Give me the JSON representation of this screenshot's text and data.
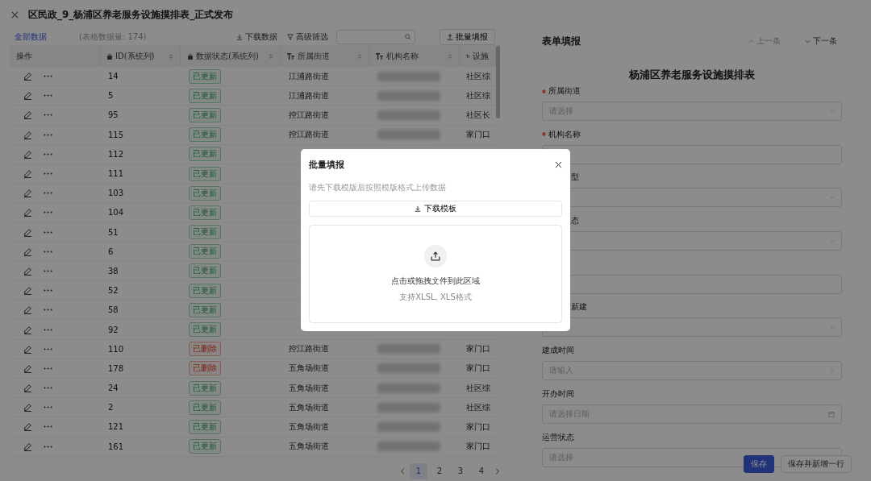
{
  "window": {
    "title": "区民政_9_杨浦区养老服务设施摸排表_正式发布"
  },
  "toolbar": {
    "view_tab": {
      "label": "全部数据",
      "selected": true
    },
    "count": "(表格数据量: 174)",
    "download": "下载数据",
    "filter": "高级筛选",
    "batch": "批量填报"
  },
  "table": {
    "columns": [
      {
        "label": "操作",
        "kind": "plain"
      },
      {
        "label": "ID(系统列)",
        "kind": "locked"
      },
      {
        "label": "数据状态(系统列)",
        "kind": "locked"
      },
      {
        "label": "所属街道",
        "kind": "text"
      },
      {
        "label": "机构名称",
        "kind": "text"
      },
      {
        "label": "设施",
        "kind": "text"
      }
    ],
    "rows": [
      {
        "id": "14",
        "status": "已更新",
        "kind": "updated",
        "street": "江浦路街道",
        "facility": "社区综"
      },
      {
        "id": "5",
        "status": "已更新",
        "kind": "updated",
        "street": "江浦路街道",
        "facility": "社区综"
      },
      {
        "id": "95",
        "status": "已更新",
        "kind": "updated",
        "street": "控江路街道",
        "facility": "社区长"
      },
      {
        "id": "115",
        "status": "已更新",
        "kind": "updated",
        "street": "控江路街道",
        "facility": "家门口"
      },
      {
        "id": "112",
        "status": "已更新",
        "kind": "updated"
      },
      {
        "id": "111",
        "status": "已更新",
        "kind": "updated"
      },
      {
        "id": "103",
        "status": "已更新",
        "kind": "updated"
      },
      {
        "id": "104",
        "status": "已更新",
        "kind": "updated"
      },
      {
        "id": "51",
        "status": "已更新",
        "kind": "updated"
      },
      {
        "id": "6",
        "status": "已更新",
        "kind": "updated"
      },
      {
        "id": "38",
        "status": "已更新",
        "kind": "updated"
      },
      {
        "id": "52",
        "status": "已更新",
        "kind": "updated"
      },
      {
        "id": "58",
        "status": "已更新",
        "kind": "updated"
      },
      {
        "id": "92",
        "status": "已更新",
        "kind": "updated"
      },
      {
        "id": "110",
        "status": "已删除",
        "kind": "deleted",
        "street": "控江路街道",
        "facility": "家门口"
      },
      {
        "id": "178",
        "status": "已删除",
        "kind": "deleted",
        "street": "五角场街道",
        "facility": "家门口"
      },
      {
        "id": "24",
        "status": "已更新",
        "kind": "updated",
        "street": "五角场街道",
        "facility": "社区综"
      },
      {
        "id": "2",
        "status": "已更新",
        "kind": "updated",
        "street": "五角场街道",
        "facility": "社区综"
      },
      {
        "id": "121",
        "status": "已更新",
        "kind": "updated",
        "street": "五角场街道",
        "facility": "家门口"
      },
      {
        "id": "161",
        "status": "已更新",
        "kind": "updated",
        "street": "五角场街道",
        "facility": "家门口"
      }
    ]
  },
  "pagination": {
    "pages": [
      {
        "label": "1",
        "selected": true
      },
      {
        "label": "2",
        "selected": false
      },
      {
        "label": "3",
        "selected": false
      },
      {
        "label": "4",
        "selected": false
      }
    ]
  },
  "form_panel": {
    "title": "表单填报",
    "prev": {
      "label": "上一条",
      "disabled": true
    },
    "next": {
      "label": "下一条",
      "disabled": false
    },
    "form_title": "杨浦区养老服务设施摸排表",
    "fields": [
      {
        "label": "所属街道",
        "required": true,
        "partial": false,
        "kind": "select",
        "placeholder": "请选择"
      },
      {
        "label": "机构名称",
        "required": true,
        "partial": false,
        "kind": "input"
      },
      {
        "label": "型",
        "required": false,
        "partial": true,
        "kind": "select"
      },
      {
        "label": "态",
        "required": false,
        "partial": true,
        "kind": "select"
      },
      {
        "kind": "input"
      },
      {
        "label": "新建",
        "required": false,
        "partial": true,
        "kind": "select"
      },
      {
        "label": "建成时间",
        "required": false,
        "partial": false,
        "kind": "number",
        "placeholder": "请输入"
      },
      {
        "label": "开办时间",
        "required": false,
        "partial": false,
        "kind": "date",
        "placeholder": "请选择日期"
      },
      {
        "label": "运营状态",
        "required": false,
        "partial": false,
        "kind": "select",
        "placeholder": "请选择"
      }
    ],
    "buttons": [
      {
        "label": "保存",
        "kind": "primary"
      },
      {
        "label": "保存并新增一行",
        "kind": "secondary"
      }
    ]
  },
  "dialog": {
    "title": "批量填报",
    "hint": "请先下载模版后按照模版格式上传数据",
    "download": "下载模板",
    "drop_text": "点击或拖拽文件到此区域",
    "formats": "支持XLSL, XLS格式"
  }
}
